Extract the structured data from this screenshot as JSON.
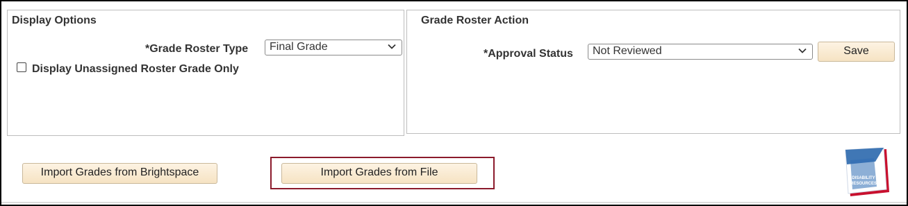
{
  "display_options": {
    "title": "Display Options",
    "roster_type_label": "*Grade Roster Type",
    "roster_type_value": "Final Grade",
    "unassigned_label": "Display Unassigned Roster Grade Only",
    "unassigned_checked": false
  },
  "grade_roster_action": {
    "title": "Grade Roster Action",
    "approval_label": "*Approval Status",
    "approval_value": "Not Reviewed",
    "save_label": "Save"
  },
  "footer": {
    "import_brightspace_label": "Import Grades from Brightspace",
    "import_file_label": "Import Grades from File",
    "logo_text_line1": "DISABILITY",
    "logo_text_line2": "RESOURCES"
  },
  "colors": {
    "highlight": "#8b1a2b",
    "button_bg": "#f6e3c3",
    "logo_red": "#c8102e",
    "logo_blue": "#1f5fa8"
  }
}
